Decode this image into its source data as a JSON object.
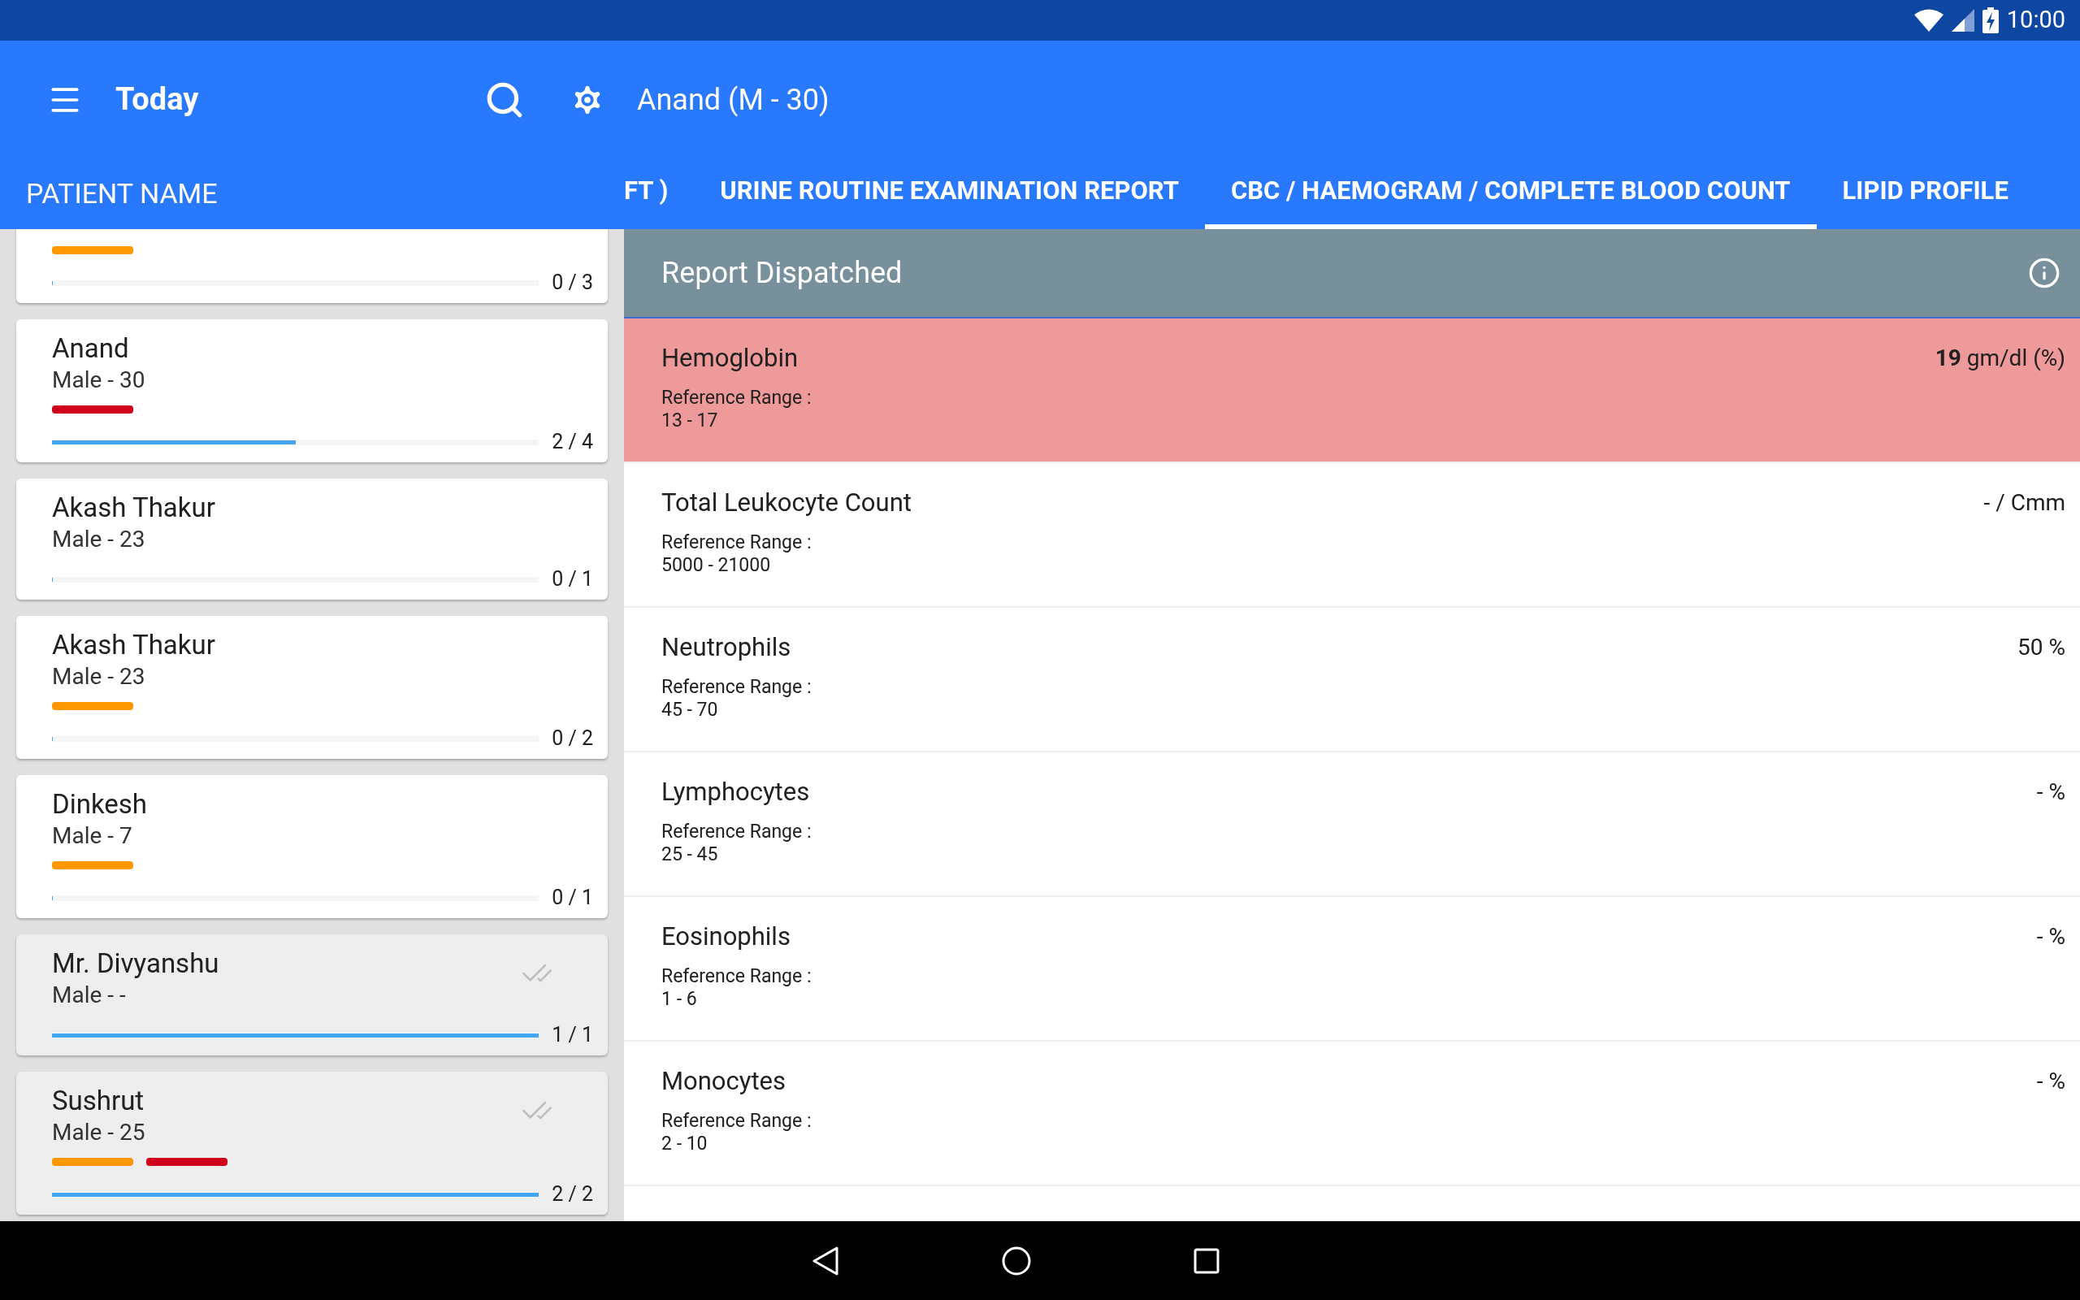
{
  "status_bar": {
    "time": "10:00"
  },
  "app_bar": {
    "title": "Today",
    "patient": "Anand (M - 30)"
  },
  "sidebar": {
    "heading": "PATIENT NAME",
    "patients": [
      {
        "flags": [
          {
            "color": "#ff9800"
          }
        ],
        "level": 0,
        "count": "0 / 3",
        "done": false
      },
      {
        "name": "Anand",
        "subtitle": "Male - 30",
        "flags": [
          {
            "color": "#d0021b"
          }
        ],
        "level": 0.5,
        "count": "2 / 4",
        "done": false
      },
      {
        "name": "Akash Thakur",
        "subtitle": "Male - 23",
        "level": 0,
        "count": "0 / 1",
        "done": false
      },
      {
        "name": "Akash Thakur",
        "subtitle": "Male - 23",
        "flags": [
          {
            "color": "#ff9800"
          }
        ],
        "level": 0,
        "count": "0 / 2",
        "done": false
      },
      {
        "name": "Dinkesh",
        "subtitle": "Male - 7",
        "flags": [
          {
            "color": "#ff9800"
          }
        ],
        "level": 0,
        "count": "0 / 1",
        "done": false
      },
      {
        "name": "Mr. Divyanshu",
        "subtitle": "Male - -",
        "level": 1,
        "count": "1 / 1",
        "done": true
      },
      {
        "name": "Sushrut",
        "subtitle": "Male - 25",
        "flags": [
          {
            "color": "#ff9800"
          },
          {
            "color": "#d0021b"
          }
        ],
        "level": 1,
        "count": "2 / 2",
        "done": true
      }
    ]
  },
  "tabs": [
    {
      "label": "FT )",
      "selected": false
    },
    {
      "label": "URINE ROUTINE EXAMINATION REPORT",
      "selected": false
    },
    {
      "label": "CBC / HAEMOGRAM / COMPLETE BLOOD COUNT",
      "selected": true
    },
    {
      "label": "LIPID PROFILE",
      "selected": false
    }
  ],
  "report": {
    "status": "Report Dispatched",
    "tests": [
      {
        "name": "Hemoglobin",
        "value": "**19** gm/dl (%)",
        "ref_label": "Reference Range :",
        "range": "13 - 17",
        "abnormal": true
      },
      {
        "name": "Total Leukocyte Count",
        "value": "- / Cmm",
        "ref_label": "Reference Range :",
        "range": "5000 - 21000",
        "abnormal": false
      },
      {
        "name": "Neutrophils",
        "value": "50 %",
        "ref_label": "Reference Range :",
        "range": "45 - 70",
        "abnormal": false
      },
      {
        "name": "Lymphocytes",
        "value": "- %",
        "ref_label": "Reference Range :",
        "range": "25 - 45",
        "abnormal": false
      },
      {
        "name": "Eosinophils",
        "value": "- %",
        "ref_label": "Reference Range :",
        "range": "1 - 6",
        "abnormal": false
      },
      {
        "name": "Monocytes",
        "value": "- %",
        "ref_label": "Reference Range :",
        "range": "2 - 10",
        "abnormal": false
      }
    ]
  }
}
